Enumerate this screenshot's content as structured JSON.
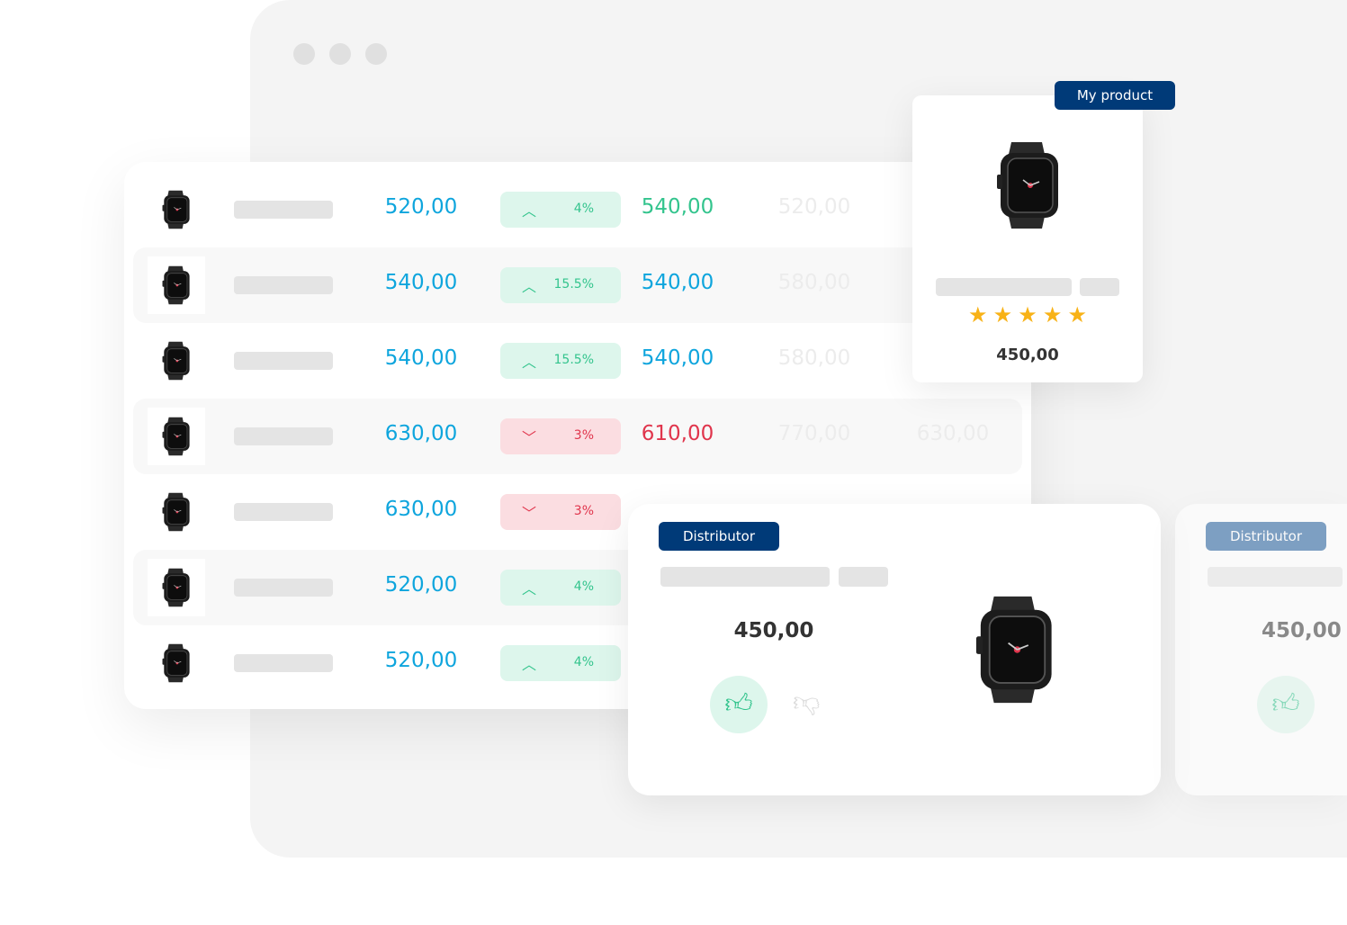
{
  "window": {
    "dots": 3
  },
  "colors": {
    "up": "#33c48d",
    "down": "#e0354c",
    "price": "#0ea5dd",
    "badge": "#003a78"
  },
  "rows": [
    {
      "price": "520,00",
      "change": "4%",
      "direction": "up",
      "new_price": "540,00",
      "new_color": "#33c48d",
      "competitor": "520,00",
      "competitor2": ""
    },
    {
      "price": "540,00",
      "change": "15.5%",
      "direction": "up",
      "new_price": "540,00",
      "new_color": "#0ea5dd",
      "competitor": "580,00",
      "competitor2": ""
    },
    {
      "price": "540,00",
      "change": "15.5%",
      "direction": "up",
      "new_price": "540,00",
      "new_color": "#0ea5dd",
      "competitor": "580,00",
      "competitor2": ""
    },
    {
      "price": "630,00",
      "change": "3%",
      "direction": "down",
      "new_price": "610,00",
      "new_color": "#e0354c",
      "competitor": "770,00",
      "competitor2": "630,00"
    },
    {
      "price": "630,00",
      "change": "3%",
      "direction": "down",
      "new_price": "",
      "new_color": "",
      "competitor": "",
      "competitor2": ""
    },
    {
      "price": "520,00",
      "change": "4%",
      "direction": "up",
      "new_price": "",
      "new_color": "",
      "competitor": "",
      "competitor2": ""
    },
    {
      "price": "520,00",
      "change": "4%",
      "direction": "up",
      "new_price": "",
      "new_color": "",
      "competitor": "",
      "competitor2": ""
    }
  ],
  "my_product": {
    "badge": "My product",
    "rating": 5,
    "price": "450,00"
  },
  "distributor": {
    "badge": "Distributor",
    "price": "450,00"
  },
  "distributor2": {
    "badge": "Distributor",
    "price": "450,00"
  }
}
